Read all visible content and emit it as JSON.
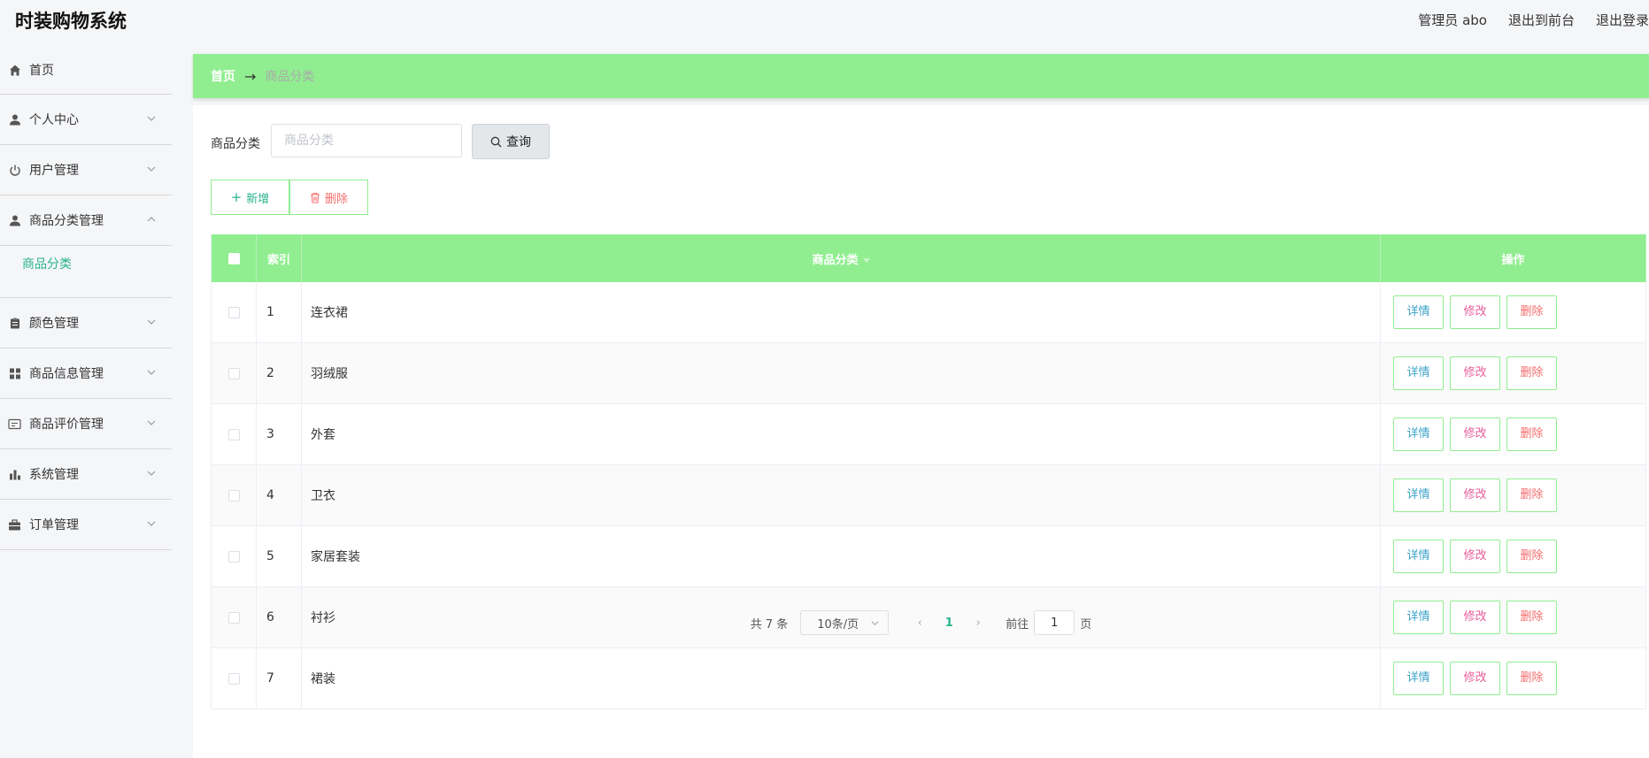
{
  "header": {
    "app_title": "时装购物系统",
    "user_label": "管理员 abo",
    "to_front": "退出到前台",
    "logout": "退出登录"
  },
  "sidebar": {
    "items": [
      {
        "label": "首页",
        "icon": "home-icon"
      },
      {
        "label": "个人中心",
        "icon": "user-icon"
      },
      {
        "label": "用户管理",
        "icon": "power-icon"
      },
      {
        "label": "商品分类管理",
        "icon": "user-icon",
        "expanded": true
      },
      {
        "label": "颜色管理",
        "icon": "clipboard-icon"
      },
      {
        "label": "商品信息管理",
        "icon": "grid-icon"
      },
      {
        "label": "商品评价管理",
        "icon": "card-icon"
      },
      {
        "label": "系统管理",
        "icon": "bar-chart-icon"
      },
      {
        "label": "订单管理",
        "icon": "briefcase-icon"
      }
    ],
    "sub_item": "商品分类"
  },
  "breadcrumb": {
    "home": "首页",
    "arrow": "→",
    "current": "商品分类"
  },
  "search": {
    "label": "商品分类",
    "placeholder": "商品分类",
    "button": "查询"
  },
  "actions": {
    "add": "新增",
    "remove": "删除"
  },
  "table": {
    "columns": [
      "索引",
      "商品分类",
      "操作"
    ],
    "rows": [
      {
        "index": "1",
        "name": "连衣裙"
      },
      {
        "index": "2",
        "name": "羽绒服"
      },
      {
        "index": "3",
        "name": "外套"
      },
      {
        "index": "4",
        "name": "卫衣"
      },
      {
        "index": "5",
        "name": "家居套装"
      },
      {
        "index": "6",
        "name": "衬衫"
      },
      {
        "index": "7",
        "name": "裙装"
      }
    ],
    "row_actions": {
      "detail": "详情",
      "edit": "修改",
      "remove": "删除"
    }
  },
  "pagination": {
    "total": "共 7 条",
    "page_size": "10条/页",
    "current_page": "1",
    "goto_label": "前往",
    "goto_value": "1",
    "page_suffix": "页"
  },
  "colors": {
    "accent_green": "#90ee90",
    "active_text": "#28b38b",
    "danger": "#f56c6c"
  }
}
